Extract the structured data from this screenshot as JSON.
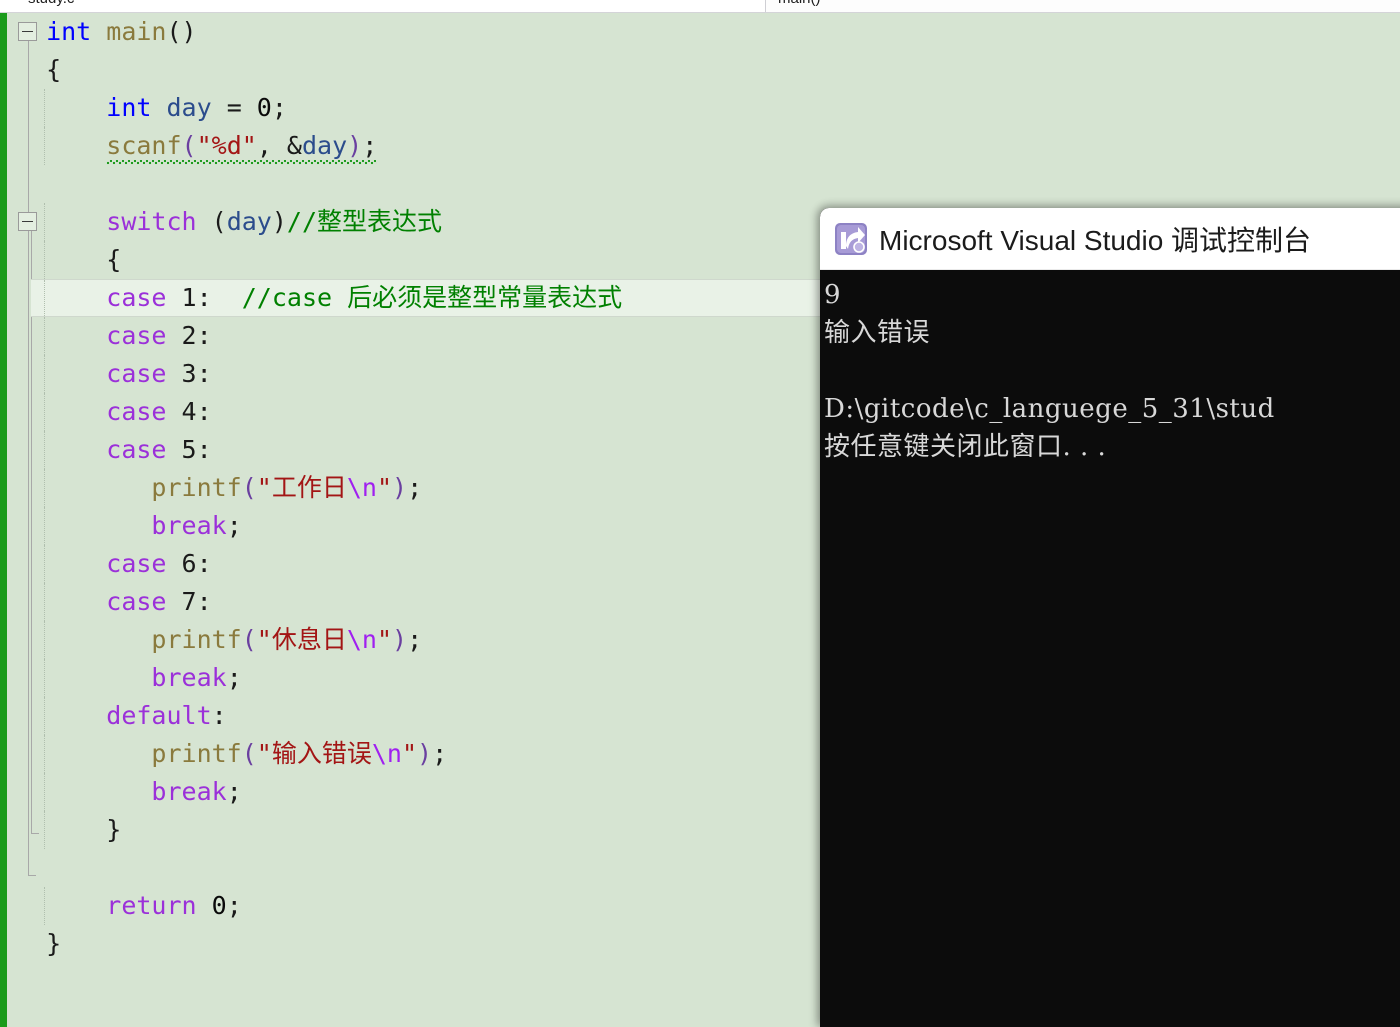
{
  "window": {
    "editor_background": "#d6e4d2",
    "change_bar_color": "#1a9b1a",
    "current_line_color": "#e9f2e7"
  },
  "toolbar": {
    "scope_combo_value": "study.c",
    "member_combo_value": "main()"
  },
  "editor": {
    "outline_markers": [
      "collapse-main",
      "collapse-switch"
    ],
    "lines": [
      {
        "indent": 0,
        "tokens": [
          {
            "t": "int",
            "c": "kw"
          },
          {
            "t": " ",
            "c": "punc"
          },
          {
            "t": "main",
            "c": "fn"
          },
          {
            "t": "()",
            "c": "punc"
          }
        ]
      },
      {
        "indent": 0,
        "tokens": [
          {
            "t": "{",
            "c": "punc"
          }
        ]
      },
      {
        "indent": 1,
        "tokens": [
          {
            "t": "int",
            "c": "kw"
          },
          {
            "t": " day ",
            "c": "var"
          },
          {
            "t": "= ",
            "c": "punc"
          },
          {
            "t": "0",
            "c": "num"
          },
          {
            "t": ";",
            "c": "punc"
          }
        ]
      },
      {
        "indent": 1,
        "squiggle": true,
        "tokens": [
          {
            "t": "scanf",
            "c": "fn"
          },
          {
            "t": "(",
            "c": "paren"
          },
          {
            "t": "\"%d\"",
            "c": "str"
          },
          {
            "t": ", ",
            "c": "punc"
          },
          {
            "t": "&",
            "c": "punc"
          },
          {
            "t": "day",
            "c": "var"
          },
          {
            "t": ")",
            "c": "paren"
          },
          {
            "t": ";",
            "c": "punc"
          }
        ]
      },
      {
        "indent": 0,
        "tokens": []
      },
      {
        "indent": 1,
        "tokens": [
          {
            "t": "switch",
            "c": "kw2"
          },
          {
            "t": " (",
            "c": "punc"
          },
          {
            "t": "day",
            "c": "var"
          },
          {
            "t": ")",
            "c": "punc"
          },
          {
            "t": "//整型表达式",
            "c": "cmt"
          }
        ]
      },
      {
        "indent": 1,
        "tokens": [
          {
            "t": "{",
            "c": "punc"
          }
        ]
      },
      {
        "indent": 1,
        "current": true,
        "tokens": [
          {
            "t": "case",
            "c": "kw2"
          },
          {
            "t": " 1:  ",
            "c": "punc"
          },
          {
            "t": "//case 后必须是整型常量表达式",
            "c": "cmt"
          }
        ]
      },
      {
        "indent": 1,
        "tokens": [
          {
            "t": "case",
            "c": "kw2"
          },
          {
            "t": " 2:",
            "c": "punc"
          }
        ]
      },
      {
        "indent": 1,
        "tokens": [
          {
            "t": "case",
            "c": "kw2"
          },
          {
            "t": " 3:",
            "c": "punc"
          }
        ]
      },
      {
        "indent": 1,
        "tokens": [
          {
            "t": "case",
            "c": "kw2"
          },
          {
            "t": " 4:",
            "c": "punc"
          }
        ]
      },
      {
        "indent": 1,
        "tokens": [
          {
            "t": "case",
            "c": "kw2"
          },
          {
            "t": " 5:",
            "c": "punc"
          }
        ]
      },
      {
        "indent": 2,
        "tokens": [
          {
            "t": "printf",
            "c": "fn"
          },
          {
            "t": "(",
            "c": "paren"
          },
          {
            "t": "\"工作日",
            "c": "str"
          },
          {
            "t": "\\n",
            "c": "esc"
          },
          {
            "t": "\"",
            "c": "str"
          },
          {
            "t": ")",
            "c": "paren"
          },
          {
            "t": ";",
            "c": "punc"
          }
        ]
      },
      {
        "indent": 2,
        "tokens": [
          {
            "t": "break",
            "c": "kw2"
          },
          {
            "t": ";",
            "c": "punc"
          }
        ]
      },
      {
        "indent": 1,
        "tokens": [
          {
            "t": "case",
            "c": "kw2"
          },
          {
            "t": " 6:",
            "c": "punc"
          }
        ]
      },
      {
        "indent": 1,
        "tokens": [
          {
            "t": "case",
            "c": "kw2"
          },
          {
            "t": " 7:",
            "c": "punc"
          }
        ]
      },
      {
        "indent": 2,
        "tokens": [
          {
            "t": "printf",
            "c": "fn"
          },
          {
            "t": "(",
            "c": "paren"
          },
          {
            "t": "\"休息日",
            "c": "str"
          },
          {
            "t": "\\n",
            "c": "esc"
          },
          {
            "t": "\"",
            "c": "str"
          },
          {
            "t": ")",
            "c": "paren"
          },
          {
            "t": ";",
            "c": "punc"
          }
        ]
      },
      {
        "indent": 2,
        "tokens": [
          {
            "t": "break",
            "c": "kw2"
          },
          {
            "t": ";",
            "c": "punc"
          }
        ]
      },
      {
        "indent": 1,
        "tokens": [
          {
            "t": "default",
            "c": "kw2"
          },
          {
            "t": ":",
            "c": "punc"
          }
        ]
      },
      {
        "indent": 2,
        "tokens": [
          {
            "t": "printf",
            "c": "fn"
          },
          {
            "t": "(",
            "c": "paren"
          },
          {
            "t": "\"输入错误",
            "c": "str"
          },
          {
            "t": "\\n",
            "c": "esc"
          },
          {
            "t": "\"",
            "c": "str"
          },
          {
            "t": ")",
            "c": "paren"
          },
          {
            "t": ";",
            "c": "punc"
          }
        ]
      },
      {
        "indent": 2,
        "tokens": [
          {
            "t": "break",
            "c": "kw2"
          },
          {
            "t": ";",
            "c": "punc"
          }
        ]
      },
      {
        "indent": 1,
        "tokens": [
          {
            "t": "}",
            "c": "punc"
          }
        ]
      },
      {
        "indent": 0,
        "tokens": []
      },
      {
        "indent": 1,
        "tokens": [
          {
            "t": "return",
            "c": "kw2"
          },
          {
            "t": " ",
            "c": "punc"
          },
          {
            "t": "0",
            "c": "num"
          },
          {
            "t": ";",
            "c": "punc"
          }
        ]
      },
      {
        "indent": 0,
        "tokens": [
          {
            "t": "}",
            "c": "punc"
          }
        ]
      }
    ]
  },
  "console": {
    "title": "Microsoft Visual Studio 调试控制台",
    "icon": "vs-debug-console-icon",
    "background": "#0c0c0c",
    "text_color": "#d8d8d8",
    "lines": [
      "9",
      "输入错误",
      "",
      "D:\\gitcode\\c_languege_5_31\\stud",
      "按任意键关闭此窗口. . ."
    ]
  }
}
